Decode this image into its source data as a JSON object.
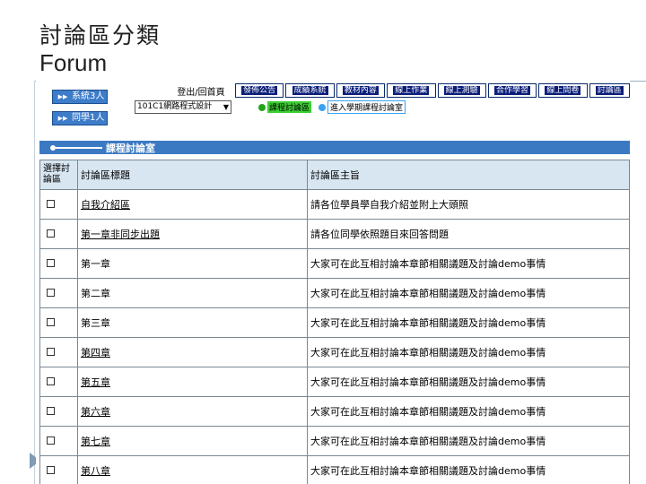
{
  "slide": {
    "title": "討論區分類",
    "subtitle": "Forum"
  },
  "sidebar": {
    "buttons": [
      {
        "label": "系統3人"
      },
      {
        "label": "同學1人"
      }
    ]
  },
  "header": {
    "login_label": "登出/回首頁",
    "course_select": {
      "value": "101C1網路程式設計"
    }
  },
  "navbar": {
    "items": [
      "發佈公告",
      "成績系統",
      "教材內容",
      "線上作業",
      "線上測驗",
      "合作學習",
      "線上問卷",
      "討論區"
    ]
  },
  "subnav": {
    "items": [
      {
        "label": "課程討論區",
        "active": true,
        "dot_color": "#22a31c"
      },
      {
        "label": "進入學期課程討論室",
        "active": false,
        "dot_color": "#37a3f2"
      }
    ]
  },
  "section": {
    "title": "課程討論室"
  },
  "table": {
    "headers": [
      "選擇討論區",
      "討論區標題",
      "討論區主旨"
    ],
    "rows": [
      {
        "title": "自我介紹區",
        "subject": "請各位學員學自我介紹並附上大頭照",
        "link": true
      },
      {
        "title": "第一章非同步出題",
        "subject": "請各位同學依照題目來回答問題",
        "link": true
      },
      {
        "title": "第一章",
        "subject": "大家可在此互相討論本章節相關議題及討論demo事情",
        "link": false
      },
      {
        "title": "第二章",
        "subject": "大家可在此互相討論本章節相關議題及討論demo事情",
        "link": false
      },
      {
        "title": "第三章",
        "subject": "大家可在此互相討論本章節相關議題及討論demo事情",
        "link": false
      },
      {
        "title": "第四章",
        "subject": "大家可在此互相討論本章節相關議題及討論demo事情",
        "link": true
      },
      {
        "title": "第五章",
        "subject": "大家可在此互相討論本章節相關議題及討論demo事情",
        "link": true
      },
      {
        "title": "第六章",
        "subject": "大家可在此互相討論本章節相關議題及討論demo事情",
        "link": true
      },
      {
        "title": "第七章",
        "subject": "大家可在此互相討論本章節相關議題及討論demo事情",
        "link": true
      },
      {
        "title": "第八章",
        "subject": "大家可在此互相討論本章節相關議題及討論demo事情",
        "link": true
      }
    ]
  }
}
